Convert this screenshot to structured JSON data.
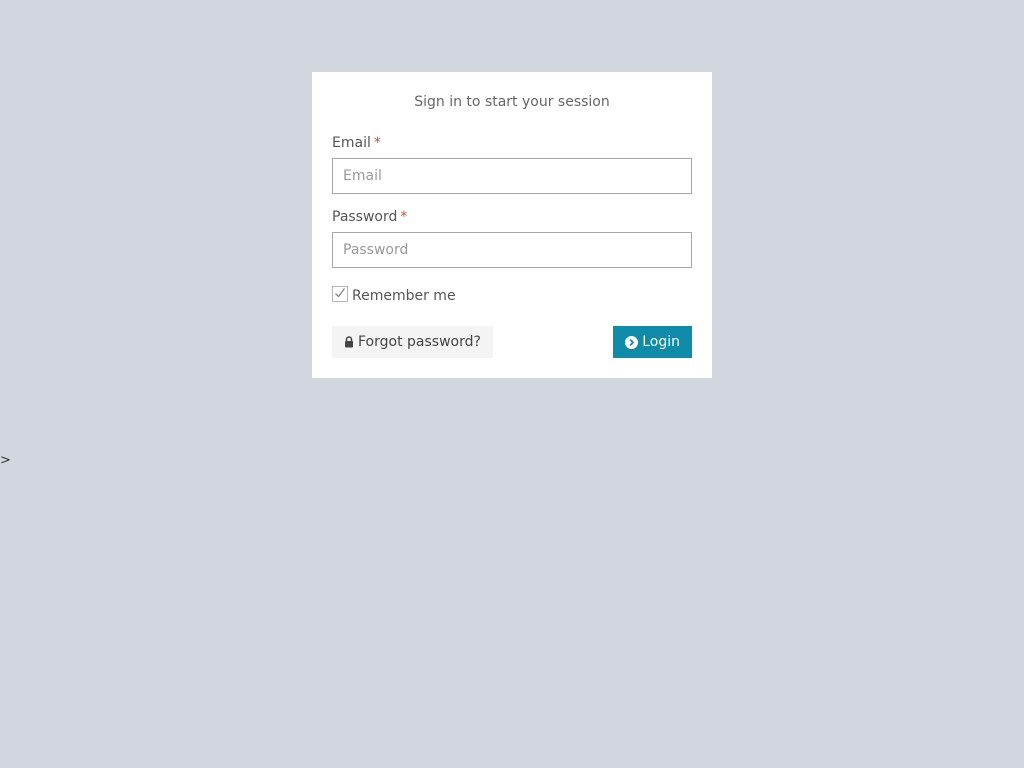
{
  "login": {
    "message": "Sign in to start your session",
    "email": {
      "label": "Email",
      "required_mark": "*",
      "placeholder": "Email",
      "value": ""
    },
    "password": {
      "label": "Password",
      "required_mark": "*",
      "placeholder": "Password",
      "value": ""
    },
    "remember": {
      "label": "Remember me",
      "checked": true
    },
    "forgot_button": {
      "label": "Forgot password?",
      "icon": "lock-icon"
    },
    "login_button": {
      "label": "Login",
      "icon": "circle-arrow-right-icon"
    }
  },
  "stray_text": ">",
  "colors": {
    "page_background": "#d2d6de",
    "login_button": "#0e8ba8",
    "required_mark": "#b35a3e"
  }
}
